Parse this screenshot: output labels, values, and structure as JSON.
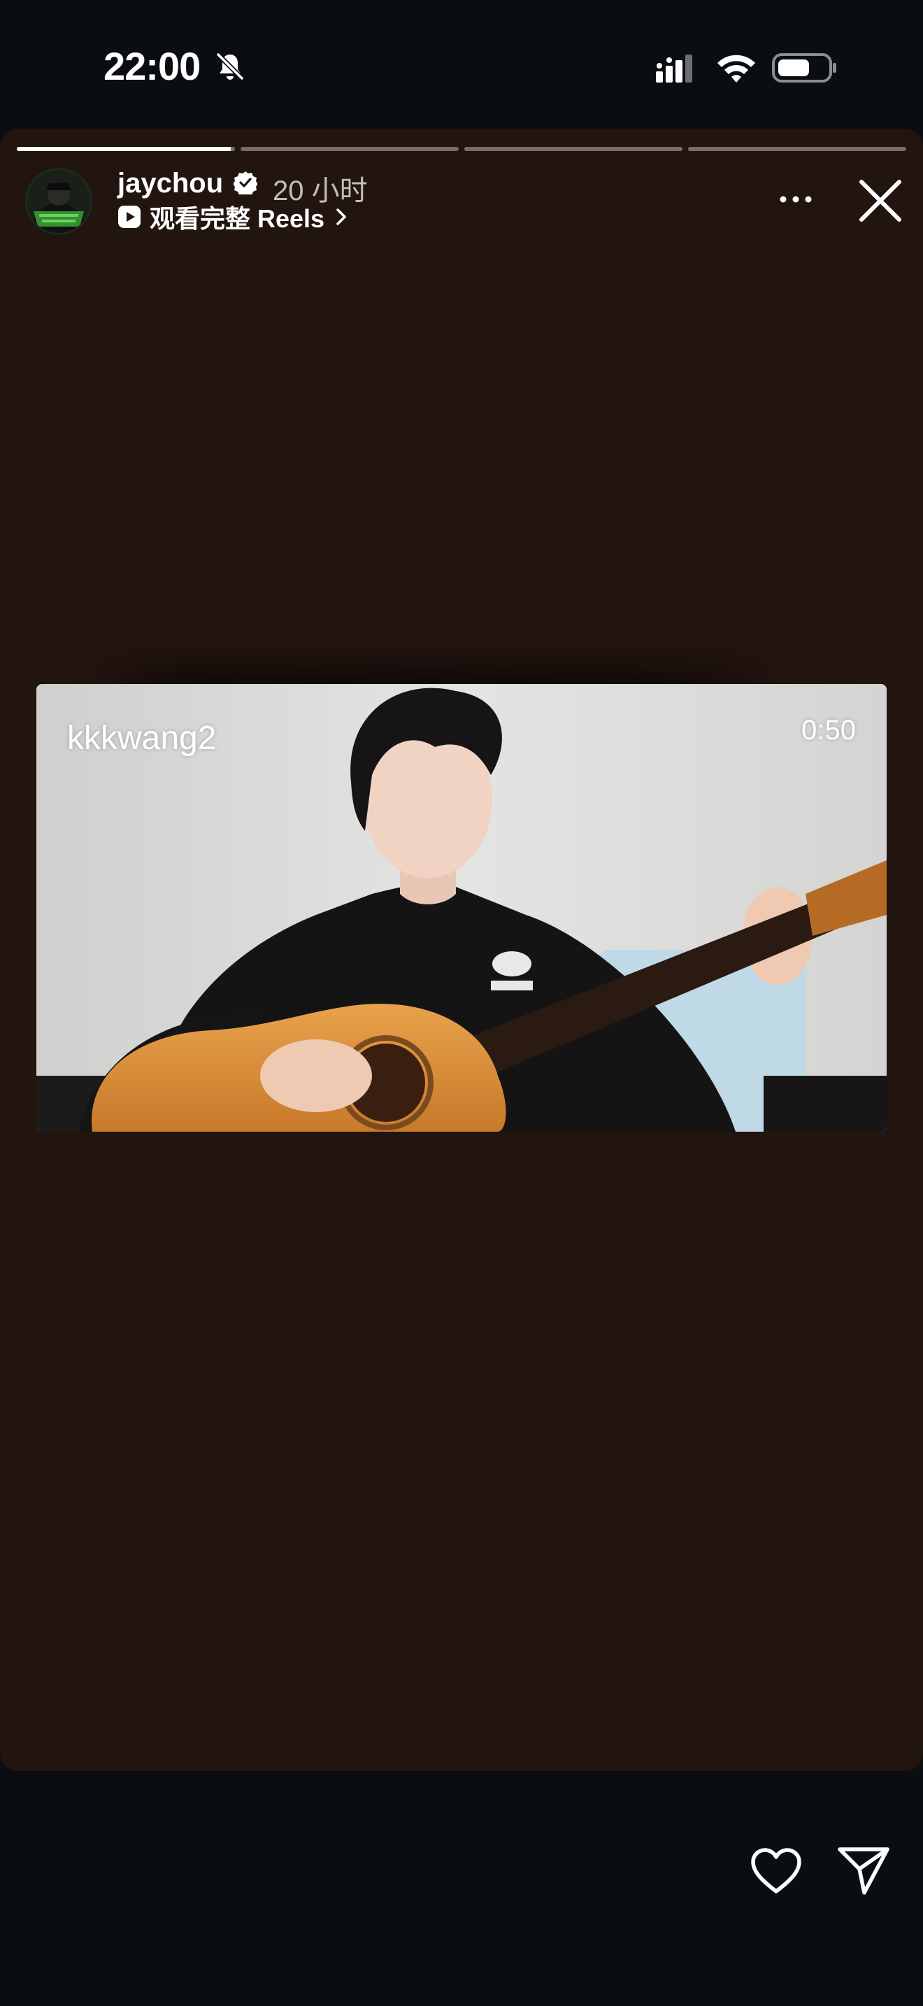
{
  "status_bar": {
    "time": "22:00",
    "icons": [
      "bell-muted-icon",
      "cellular-signal-icon",
      "wifi-icon",
      "battery-icon"
    ]
  },
  "story": {
    "progress_segments": [
      0.98,
      0.0,
      0.0,
      0.0
    ],
    "username": "jaychou",
    "verified": true,
    "time_ago": "20 小时",
    "reels_link_label": "观看完整 Reels",
    "video": {
      "author": "kkkwang2",
      "duration": "0:50"
    }
  },
  "colors": {
    "background": "#0a0e13",
    "story_card": "#22140f",
    "verified_badge": "#ffffff"
  },
  "actions": [
    "heart-icon",
    "send-icon"
  ]
}
